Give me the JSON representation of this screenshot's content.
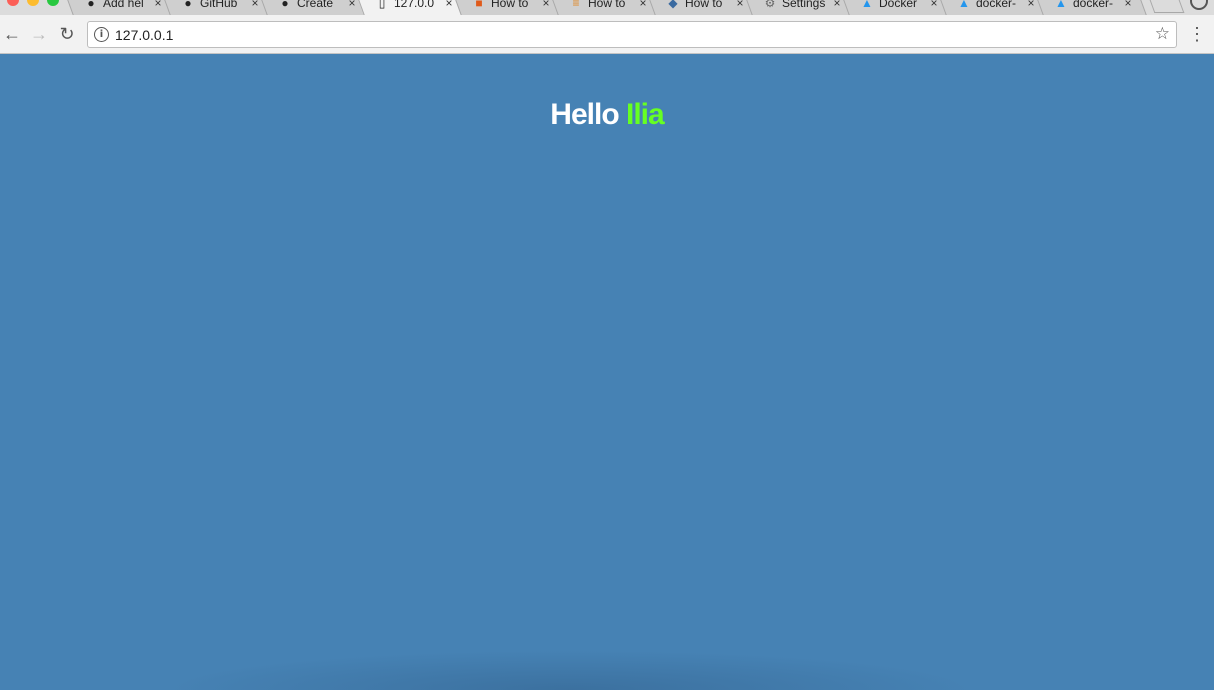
{
  "browser": {
    "tabs": [
      {
        "title": "Add hel",
        "icon": "github-icon"
      },
      {
        "title": "GitHub",
        "icon": "github-icon"
      },
      {
        "title": "Create",
        "icon": "github-icon"
      },
      {
        "title": "127.0.0",
        "icon": "document-icon",
        "active": true
      },
      {
        "title": "How to",
        "icon": "askubuntu-icon"
      },
      {
        "title": "How to",
        "icon": "stackoverflow-icon"
      },
      {
        "title": "How to",
        "icon": "site-icon"
      },
      {
        "title": "Settings",
        "icon": "gear-icon"
      },
      {
        "title": "Docker",
        "icon": "docker-icon"
      },
      {
        "title": "docker-",
        "icon": "docker-icon"
      },
      {
        "title": "docker-",
        "icon": "docker-icon"
      }
    ],
    "close_symbol": "×",
    "address": "127.0.0.1"
  },
  "page": {
    "hello": "Hello",
    "name": "Ilia",
    "background_color": "#4682b4",
    "name_color": "#66ff22"
  }
}
